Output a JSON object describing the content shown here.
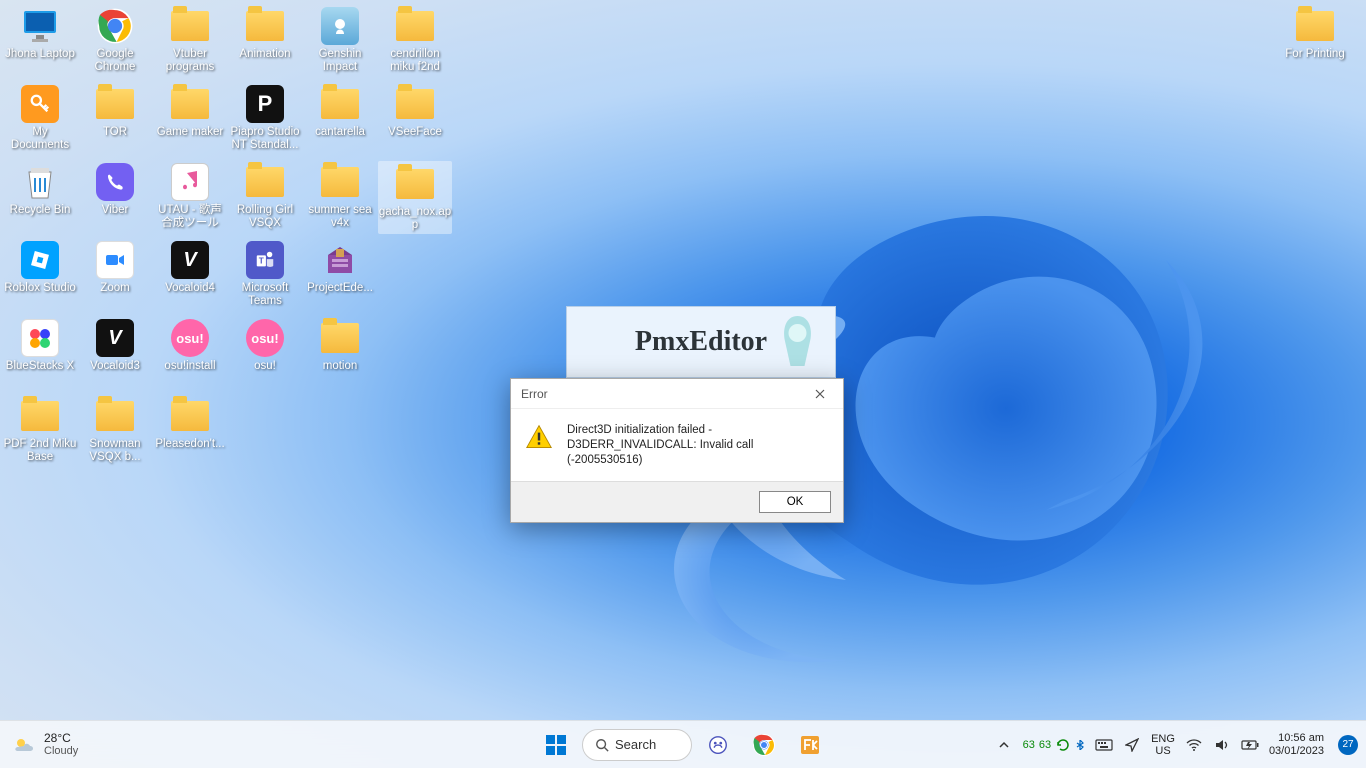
{
  "desktop": {
    "icons": [
      {
        "label": "Jhona Laptop",
        "type": "monitor",
        "col": 0,
        "row": 0
      },
      {
        "label": "Google Chrome",
        "type": "chrome",
        "col": 1,
        "row": 0
      },
      {
        "label": "Vtuber programs",
        "type": "folder",
        "col": 2,
        "row": 0
      },
      {
        "label": "Animation",
        "type": "folder",
        "col": 3,
        "row": 0
      },
      {
        "label": "Genshin Impact",
        "type": "genshin",
        "col": 4,
        "row": 0
      },
      {
        "label": "cendrillon miku f2nd",
        "type": "folder",
        "col": 5,
        "row": 0
      },
      {
        "label": "For Printing",
        "type": "folder",
        "col": 17,
        "row": 0
      },
      {
        "label": "My Documents",
        "type": "key",
        "col": 0,
        "row": 1
      },
      {
        "label": "TOR",
        "type": "folder",
        "col": 1,
        "row": 1
      },
      {
        "label": "Game maker",
        "type": "folder",
        "col": 2,
        "row": 1
      },
      {
        "label": "Piapro Studio NT Standal...",
        "type": "piapro",
        "col": 3,
        "row": 1
      },
      {
        "label": "cantarella",
        "type": "folder",
        "col": 4,
        "row": 1
      },
      {
        "label": "VSeeFace",
        "type": "folder",
        "col": 5,
        "row": 1
      },
      {
        "label": "Recycle Bin",
        "type": "recycle",
        "col": 0,
        "row": 2
      },
      {
        "label": "Viber",
        "type": "viber",
        "col": 1,
        "row": 2
      },
      {
        "label": "UTAU - 歌声合成ツール",
        "type": "utau",
        "col": 2,
        "row": 2
      },
      {
        "label": "Rolling Girl VSQX",
        "type": "folder",
        "col": 3,
        "row": 2
      },
      {
        "label": "summer sea v4x",
        "type": "folder",
        "col": 4,
        "row": 2
      },
      {
        "label": "gacha_nox.app",
        "type": "folder-sel",
        "col": 5,
        "row": 2
      },
      {
        "label": "Roblox Studio",
        "type": "roblox",
        "col": 0,
        "row": 3
      },
      {
        "label": "Zoom",
        "type": "zoom",
        "col": 1,
        "row": 3
      },
      {
        "label": "Vocaloid4",
        "type": "v4",
        "col": 2,
        "row": 3
      },
      {
        "label": "Microsoft Teams",
        "type": "teams",
        "col": 3,
        "row": 3
      },
      {
        "label": "ProjectEde...",
        "type": "winrar",
        "col": 4,
        "row": 3
      },
      {
        "label": "BlueStacks X",
        "type": "bluestacks",
        "col": 0,
        "row": 4
      },
      {
        "label": "Vocaloid3",
        "type": "v3",
        "col": 1,
        "row": 4
      },
      {
        "label": "osu!install",
        "type": "osu",
        "col": 2,
        "row": 4
      },
      {
        "label": "osu!",
        "type": "osu",
        "col": 3,
        "row": 4
      },
      {
        "label": "motion",
        "type": "folder",
        "col": 4,
        "row": 4
      },
      {
        "label": "PDF 2nd Miku Base",
        "type": "folder",
        "col": 0,
        "row": 5
      },
      {
        "label": "Snowman VSQX b...",
        "type": "folder",
        "col": 1,
        "row": 5
      },
      {
        "label": "Pleasedon't...",
        "type": "folder",
        "col": 2,
        "row": 5
      }
    ]
  },
  "splash": {
    "title": "PmxEditor"
  },
  "dialog": {
    "title": "Error",
    "message": "Direct3D initialization failed - D3DERR_INVALIDCALL: Invalid call (-2005530516)",
    "ok": "OK"
  },
  "taskbar": {
    "weather": {
      "temp": "28°C",
      "cond": "Cloudy"
    },
    "search": "Search",
    "perf": {
      "a": "63",
      "b": "63"
    },
    "lang": {
      "a": "ENG",
      "b": "US"
    },
    "clock": {
      "time": "10:56 am",
      "date": "03/01/2023"
    },
    "notif": "27"
  }
}
